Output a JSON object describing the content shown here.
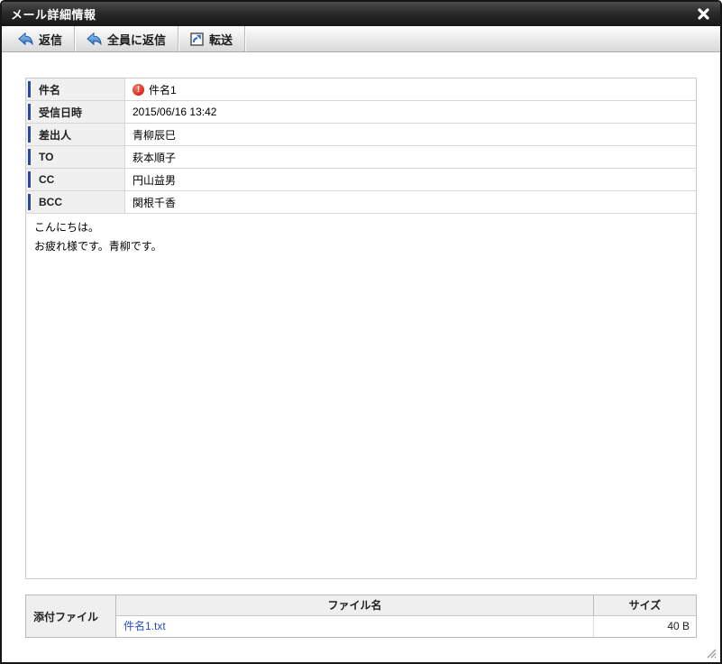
{
  "dialog": {
    "title": "メール詳細情報"
  },
  "toolbar": {
    "reply_label": "返信",
    "reply_all_label": "全員に返信",
    "forward_label": "転送"
  },
  "mail": {
    "fields": [
      {
        "label": "件名",
        "value": "件名1",
        "important": true
      },
      {
        "label": "受信日時",
        "value": "2015/06/16 13:42",
        "important": false
      },
      {
        "label": "差出人",
        "value": "青柳辰巳",
        "important": false
      },
      {
        "label": "TO",
        "value": "萩本順子",
        "important": false
      },
      {
        "label": "CC",
        "value": "円山益男",
        "important": false
      },
      {
        "label": "BCC",
        "value": "関根千香",
        "important": false
      }
    ],
    "important_glyph": "!",
    "body_lines": [
      "こんにちは。",
      "お疲れ様です。青柳です。"
    ]
  },
  "attachments": {
    "section_label": "添付ファイル",
    "columns": {
      "filename": "ファイル名",
      "size": "サイズ"
    },
    "rows": [
      {
        "filename": "件名1.txt",
        "size": "40 B"
      }
    ]
  },
  "colors": {
    "accent_navy": "#2b4a9b",
    "link_blue": "#2b50c8",
    "important_red": "#d93025",
    "titlebar_dark": "#2b2b2b"
  }
}
